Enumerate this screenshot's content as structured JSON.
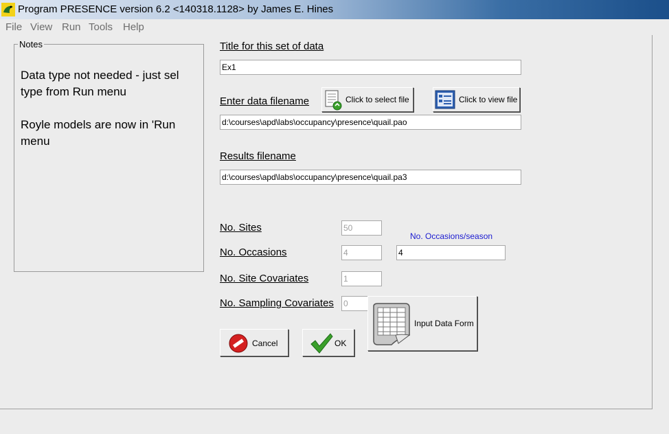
{
  "window": {
    "title": "Program PRESENCE version 6.2 <140318.1128> by James E. Hines"
  },
  "menu": [
    "File",
    "View",
    "Run",
    "Tools",
    "Help"
  ],
  "notes": {
    "legend": "Notes",
    "line1": "Data type not needed - just sel",
    "line2": "type from Run menu",
    "line3": "Royle models are now in 'Run",
    "line4": "menu"
  },
  "form": {
    "title_label": "Title for this set of data",
    "title_value": "Ex1",
    "data_label": "Enter data filename",
    "select_file_label": "Click to select file",
    "view_file_label": "Click to view file",
    "data_value": "d:\\courses\\apd\\labs\\occupancy\\presence\\quail.pao",
    "results_label": "Results filename",
    "results_value": "d:\\courses\\apd\\labs\\occupancy\\presence\\quail.pa3",
    "sites_label": "No. Sites",
    "sites_value": "50",
    "occasions_label": "No. Occasions",
    "occasions_value": "4",
    "occ_season_label": "No. Occasions/season",
    "occ_season_value": "4",
    "site_cov_label": "No. Site Covariates",
    "site_cov_value": "1",
    "samp_cov_label": "No. Sampling Covariates",
    "samp_cov_value": "0",
    "input_form_label": "Input Data Form",
    "cancel_label": "Cancel",
    "ok_label": "OK"
  },
  "colors": {
    "accent_blue": "#1a1ad0",
    "cancel_red": "#d42020",
    "ok_green": "#3aa02a"
  }
}
